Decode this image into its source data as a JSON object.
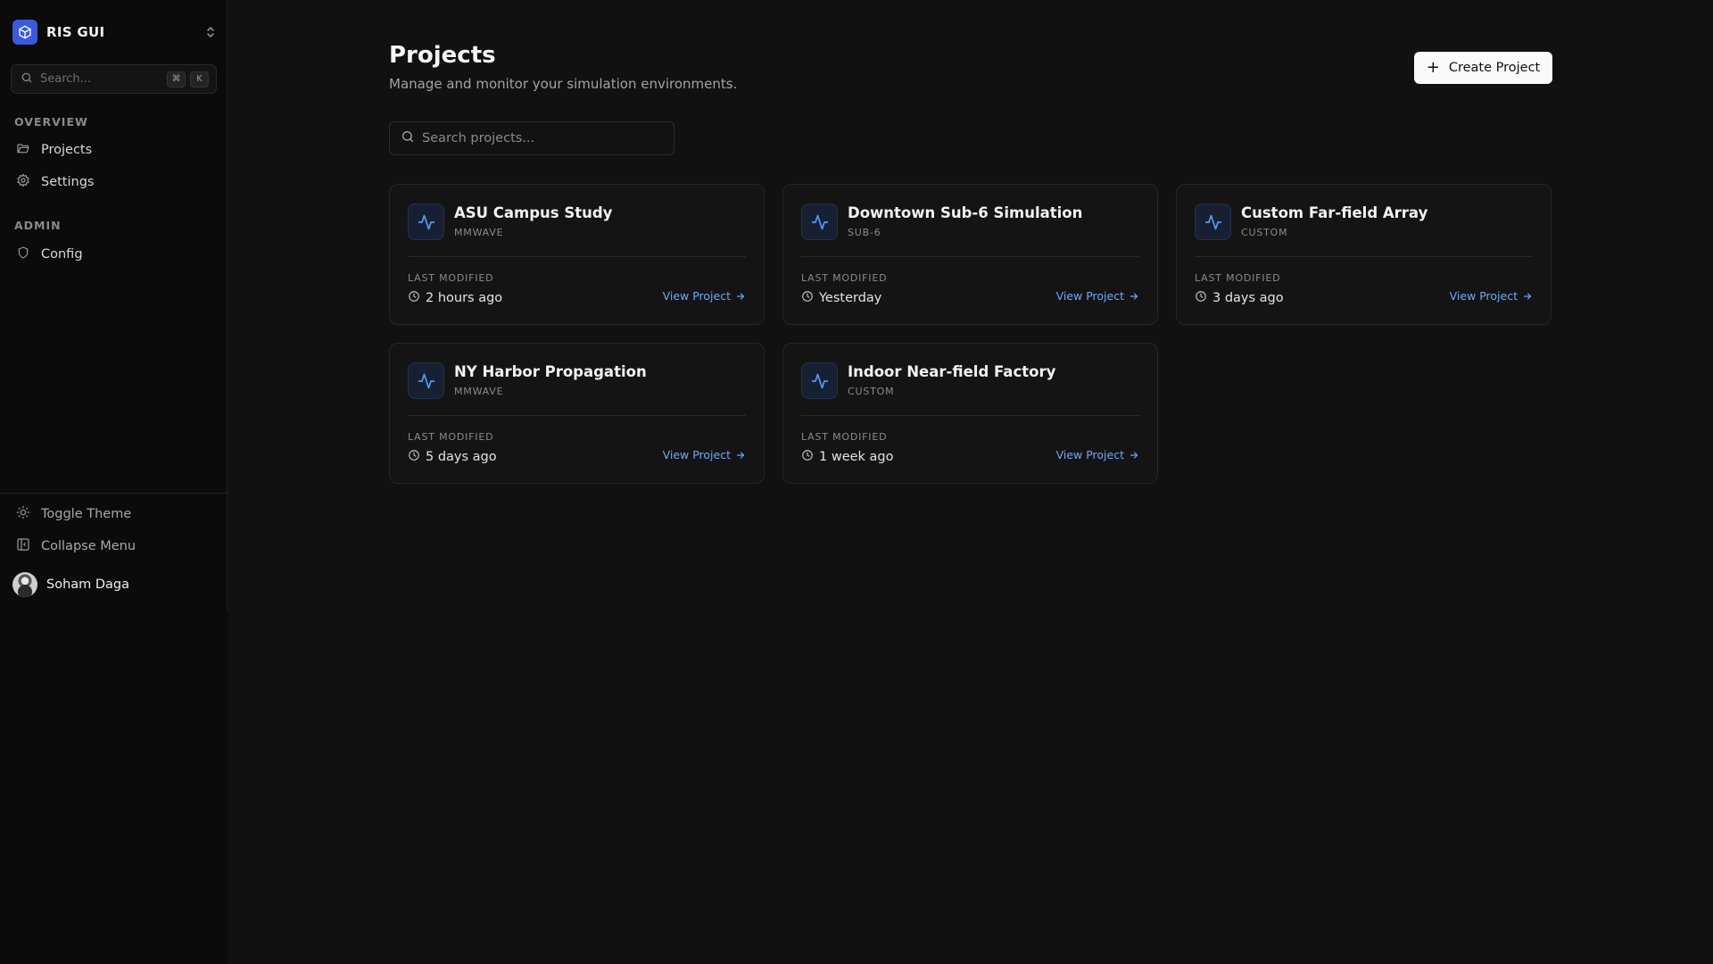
{
  "sidebar": {
    "app_name": "RIS GUI",
    "search_placeholder": "Search...",
    "shortcut_keys": [
      "⌘",
      "K"
    ],
    "sections": [
      {
        "label": "OVERVIEW",
        "items": [
          {
            "label": "Projects",
            "icon": "folder-icon"
          },
          {
            "label": "Settings",
            "icon": "gear-icon"
          }
        ]
      },
      {
        "label": "ADMIN",
        "items": [
          {
            "label": "Config",
            "icon": "shield-icon"
          }
        ]
      }
    ],
    "bottom": {
      "toggle_theme": "Toggle Theme",
      "collapse_menu": "Collapse Menu",
      "user_name": "Soham Daga"
    }
  },
  "main": {
    "title": "Projects",
    "subtitle": "Manage and monitor your simulation environments.",
    "create_button": "Create Project",
    "search_placeholder": "Search projects...",
    "last_modified_label": "LAST MODIFIED",
    "view_label": "View Project",
    "projects": [
      {
        "name": "ASU Campus Study",
        "tag": "MMWAVE",
        "modified": "2 hours ago"
      },
      {
        "name": "Downtown Sub-6 Simulation",
        "tag": "SUB-6",
        "modified": "Yesterday"
      },
      {
        "name": "Custom Far-field Array",
        "tag": "CUSTOM",
        "modified": "3 days ago"
      },
      {
        "name": "NY Harbor Propagation",
        "tag": "MMWAVE",
        "modified": "5 days ago"
      },
      {
        "name": "Indoor Near-field Factory",
        "tag": "CUSTOM",
        "modified": "1 week ago"
      }
    ]
  },
  "colors": {
    "background": "#111111",
    "sidebar": "#0b0b0b",
    "accent": "#6ea8fe",
    "brand": "#3b5bdb"
  }
}
